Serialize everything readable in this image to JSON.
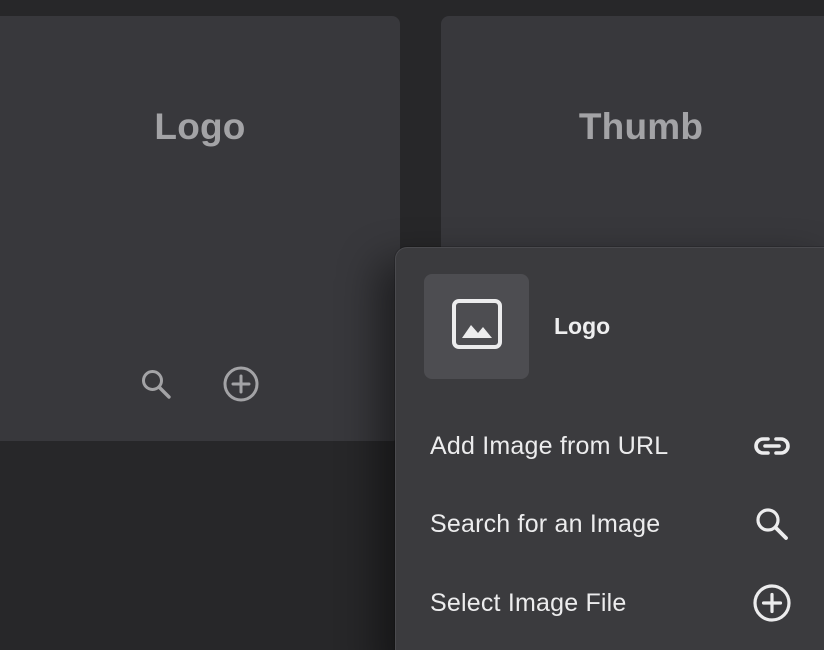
{
  "cards": [
    {
      "title": "Logo",
      "actions": [
        "search-icon",
        "plus-circle-icon"
      ]
    },
    {
      "title": "Thumb"
    }
  ],
  "popover": {
    "title": "Logo",
    "thumb_icon": "image-icon",
    "items": [
      {
        "label": "Add Image from URL",
        "icon": "link-icon"
      },
      {
        "label": "Search for an Image",
        "icon": "search-icon"
      },
      {
        "label": "Select Image File",
        "icon": "plus-circle-icon"
      }
    ]
  },
  "colors": {
    "background": "#272729",
    "card": "#38383c",
    "card_text": "#a3a3a6",
    "popover": "#3b3b3e",
    "popover_text": "#ececed"
  }
}
